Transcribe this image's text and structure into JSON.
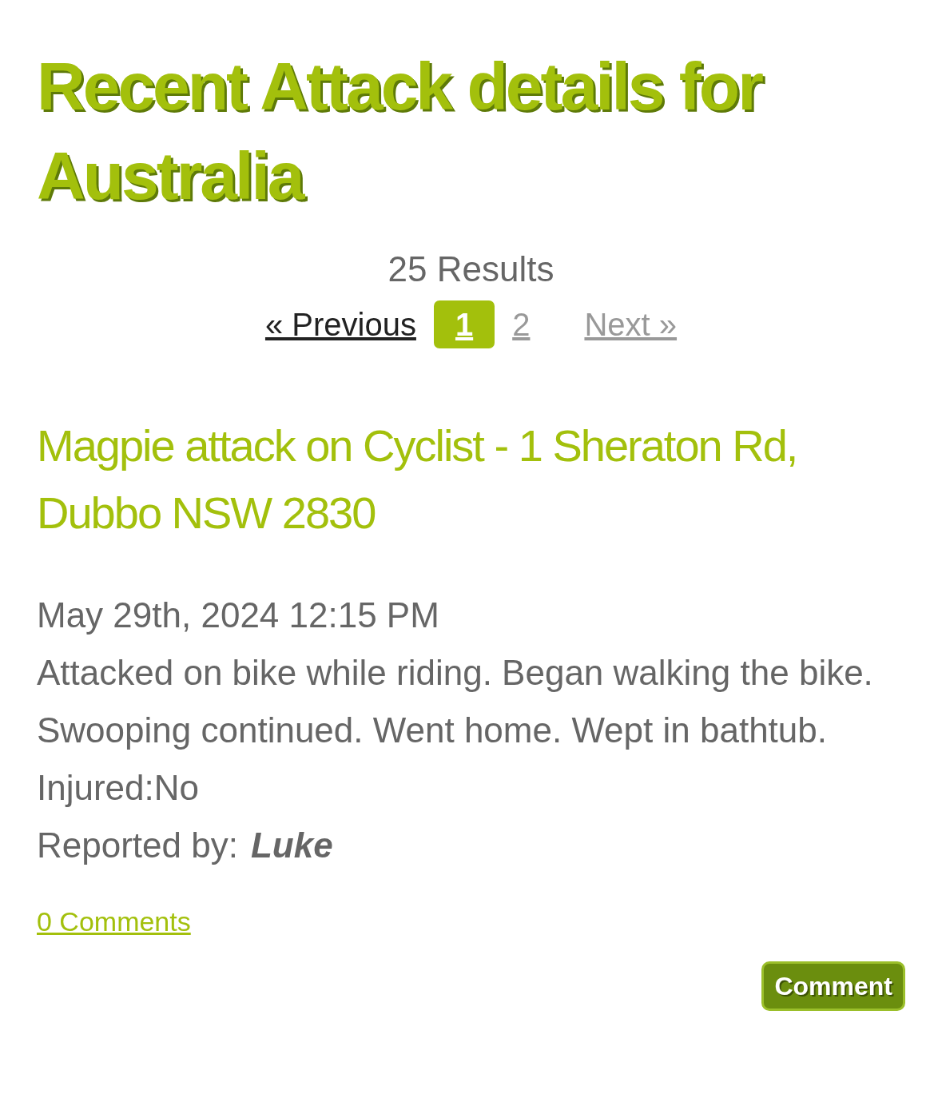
{
  "page_title": "Recent Attack details for Australia",
  "results": "25 Results",
  "pagination": {
    "previous": {
      "label": "« Previous",
      "disabled": false
    },
    "pages": [
      {
        "label": "1",
        "selected": true
      },
      {
        "label": "2",
        "selected": false
      }
    ],
    "next": {
      "label": "Next »",
      "disabled": true
    }
  },
  "reports": [
    {
      "title": "Magpie attack on Cyclist - 1 Sheraton Rd, Dubbo NSW 2830",
      "date": "May 29th, 2024 12:15 PM",
      "description": "Attacked on bike while riding. Began walking the bike. Swooping continued. Went home. Wept in bathtub.",
      "injured": "Injured:No",
      "reporter_label": "Reported by:",
      "reporter": "Luke",
      "comments_link": "0 Comments",
      "comment_button": "Comment"
    }
  ]
}
